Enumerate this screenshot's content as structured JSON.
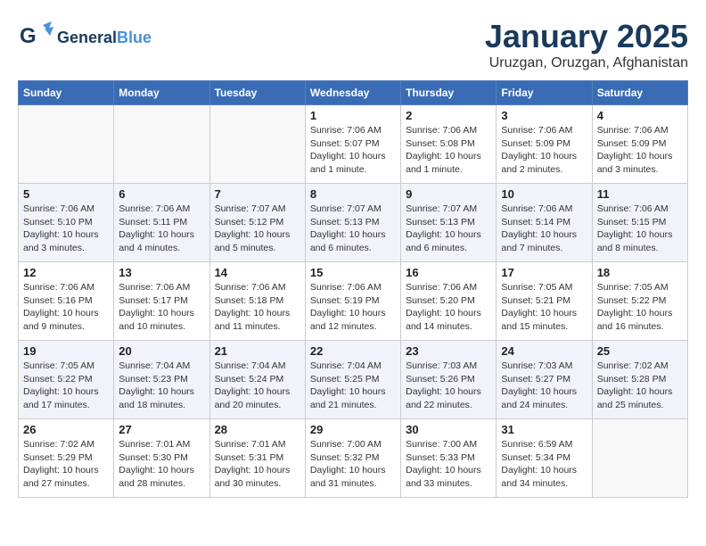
{
  "header": {
    "logo_general": "General",
    "logo_blue": "Blue",
    "month_title": "January 2025",
    "subtitle": "Uruzgan, Oruzgan, Afghanistan"
  },
  "weekdays": [
    "Sunday",
    "Monday",
    "Tuesday",
    "Wednesday",
    "Thursday",
    "Friday",
    "Saturday"
  ],
  "weeks": [
    [
      {
        "day": "",
        "info": ""
      },
      {
        "day": "",
        "info": ""
      },
      {
        "day": "",
        "info": ""
      },
      {
        "day": "1",
        "info": "Sunrise: 7:06 AM\nSunset: 5:07 PM\nDaylight: 10 hours\nand 1 minute."
      },
      {
        "day": "2",
        "info": "Sunrise: 7:06 AM\nSunset: 5:08 PM\nDaylight: 10 hours\nand 1 minute."
      },
      {
        "day": "3",
        "info": "Sunrise: 7:06 AM\nSunset: 5:09 PM\nDaylight: 10 hours\nand 2 minutes."
      },
      {
        "day": "4",
        "info": "Sunrise: 7:06 AM\nSunset: 5:09 PM\nDaylight: 10 hours\nand 3 minutes."
      }
    ],
    [
      {
        "day": "5",
        "info": "Sunrise: 7:06 AM\nSunset: 5:10 PM\nDaylight: 10 hours\nand 3 minutes."
      },
      {
        "day": "6",
        "info": "Sunrise: 7:06 AM\nSunset: 5:11 PM\nDaylight: 10 hours\nand 4 minutes."
      },
      {
        "day": "7",
        "info": "Sunrise: 7:07 AM\nSunset: 5:12 PM\nDaylight: 10 hours\nand 5 minutes."
      },
      {
        "day": "8",
        "info": "Sunrise: 7:07 AM\nSunset: 5:13 PM\nDaylight: 10 hours\nand 6 minutes."
      },
      {
        "day": "9",
        "info": "Sunrise: 7:07 AM\nSunset: 5:13 PM\nDaylight: 10 hours\nand 6 minutes."
      },
      {
        "day": "10",
        "info": "Sunrise: 7:06 AM\nSunset: 5:14 PM\nDaylight: 10 hours\nand 7 minutes."
      },
      {
        "day": "11",
        "info": "Sunrise: 7:06 AM\nSunset: 5:15 PM\nDaylight: 10 hours\nand 8 minutes."
      }
    ],
    [
      {
        "day": "12",
        "info": "Sunrise: 7:06 AM\nSunset: 5:16 PM\nDaylight: 10 hours\nand 9 minutes."
      },
      {
        "day": "13",
        "info": "Sunrise: 7:06 AM\nSunset: 5:17 PM\nDaylight: 10 hours\nand 10 minutes."
      },
      {
        "day": "14",
        "info": "Sunrise: 7:06 AM\nSunset: 5:18 PM\nDaylight: 10 hours\nand 11 minutes."
      },
      {
        "day": "15",
        "info": "Sunrise: 7:06 AM\nSunset: 5:19 PM\nDaylight: 10 hours\nand 12 minutes."
      },
      {
        "day": "16",
        "info": "Sunrise: 7:06 AM\nSunset: 5:20 PM\nDaylight: 10 hours\nand 14 minutes."
      },
      {
        "day": "17",
        "info": "Sunrise: 7:05 AM\nSunset: 5:21 PM\nDaylight: 10 hours\nand 15 minutes."
      },
      {
        "day": "18",
        "info": "Sunrise: 7:05 AM\nSunset: 5:22 PM\nDaylight: 10 hours\nand 16 minutes."
      }
    ],
    [
      {
        "day": "19",
        "info": "Sunrise: 7:05 AM\nSunset: 5:22 PM\nDaylight: 10 hours\nand 17 minutes."
      },
      {
        "day": "20",
        "info": "Sunrise: 7:04 AM\nSunset: 5:23 PM\nDaylight: 10 hours\nand 18 minutes."
      },
      {
        "day": "21",
        "info": "Sunrise: 7:04 AM\nSunset: 5:24 PM\nDaylight: 10 hours\nand 20 minutes."
      },
      {
        "day": "22",
        "info": "Sunrise: 7:04 AM\nSunset: 5:25 PM\nDaylight: 10 hours\nand 21 minutes."
      },
      {
        "day": "23",
        "info": "Sunrise: 7:03 AM\nSunset: 5:26 PM\nDaylight: 10 hours\nand 22 minutes."
      },
      {
        "day": "24",
        "info": "Sunrise: 7:03 AM\nSunset: 5:27 PM\nDaylight: 10 hours\nand 24 minutes."
      },
      {
        "day": "25",
        "info": "Sunrise: 7:02 AM\nSunset: 5:28 PM\nDaylight: 10 hours\nand 25 minutes."
      }
    ],
    [
      {
        "day": "26",
        "info": "Sunrise: 7:02 AM\nSunset: 5:29 PM\nDaylight: 10 hours\nand 27 minutes."
      },
      {
        "day": "27",
        "info": "Sunrise: 7:01 AM\nSunset: 5:30 PM\nDaylight: 10 hours\nand 28 minutes."
      },
      {
        "day": "28",
        "info": "Sunrise: 7:01 AM\nSunset: 5:31 PM\nDaylight: 10 hours\nand 30 minutes."
      },
      {
        "day": "29",
        "info": "Sunrise: 7:00 AM\nSunset: 5:32 PM\nDaylight: 10 hours\nand 31 minutes."
      },
      {
        "day": "30",
        "info": "Sunrise: 7:00 AM\nSunset: 5:33 PM\nDaylight: 10 hours\nand 33 minutes."
      },
      {
        "day": "31",
        "info": "Sunrise: 6:59 AM\nSunset: 5:34 PM\nDaylight: 10 hours\nand 34 minutes."
      },
      {
        "day": "",
        "info": ""
      }
    ]
  ]
}
